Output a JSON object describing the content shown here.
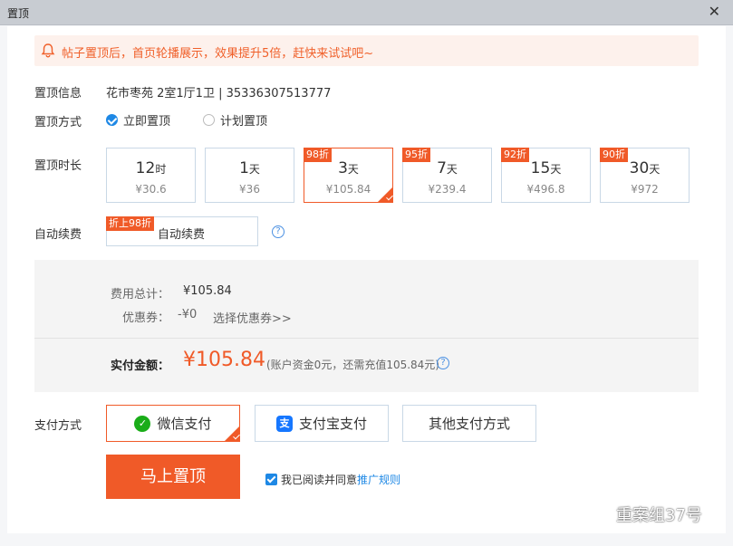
{
  "window": {
    "title": "置顶"
  },
  "notice": {
    "text": "帖子置顶后，首页轮播展示，效果提升5倍，赶快来试试吧~"
  },
  "listing": {
    "label": "置顶信息",
    "value": "花市枣苑 2室1厅1卫 | 35336307513777"
  },
  "method": {
    "label": "置顶方式",
    "options": [
      {
        "label": "立即置顶",
        "selected": true
      },
      {
        "label": "计划置顶",
        "selected": false
      }
    ]
  },
  "duration": {
    "label": "置顶时长",
    "options": [
      {
        "num": "12",
        "unit": "时",
        "price": "¥30.6",
        "tag": ""
      },
      {
        "num": "1",
        "unit": "天",
        "price": "¥36",
        "tag": ""
      },
      {
        "num": "3",
        "unit": "天",
        "price": "¥105.84",
        "tag": "98折",
        "selected": true
      },
      {
        "num": "7",
        "unit": "天",
        "price": "¥239.4",
        "tag": "95折"
      },
      {
        "num": "15",
        "unit": "天",
        "price": "¥496.8",
        "tag": "92折"
      },
      {
        "num": "30",
        "unit": "天",
        "price": "¥972",
        "tag": "90折"
      }
    ]
  },
  "auto_renew": {
    "label": "自动续费",
    "tag": "折上98折",
    "text": "自动续费",
    "help": "?"
  },
  "summary": {
    "total_label": "费用总计：",
    "total_value": "¥105.84",
    "coupon_label": "优惠券：",
    "coupon_value": "-¥0",
    "coupon_link": "选择优惠券>>",
    "pay_label": "实付金额：",
    "pay_value": "¥105.84",
    "pay_note": "(账户资金0元，还需充值105.84元)"
  },
  "payment": {
    "label": "支付方式",
    "options": [
      {
        "label": "微信支付",
        "icon": "wechat-icon",
        "selected": true
      },
      {
        "label": "支付宝支付",
        "icon": "alipay-icon",
        "selected": false
      },
      {
        "label": "其他支付方式",
        "icon": "",
        "selected": false
      }
    ]
  },
  "submit": {
    "label": "马上置顶"
  },
  "agreement": {
    "text": "我已阅读并同意",
    "link": "推广规则",
    "checked": true
  },
  "watermark": {
    "text": "重案组37号"
  },
  "colors": {
    "accent": "#f05a28",
    "link": "#1e88e5",
    "notice_bg": "#fdf1ec",
    "border": "#c9d8e6"
  }
}
